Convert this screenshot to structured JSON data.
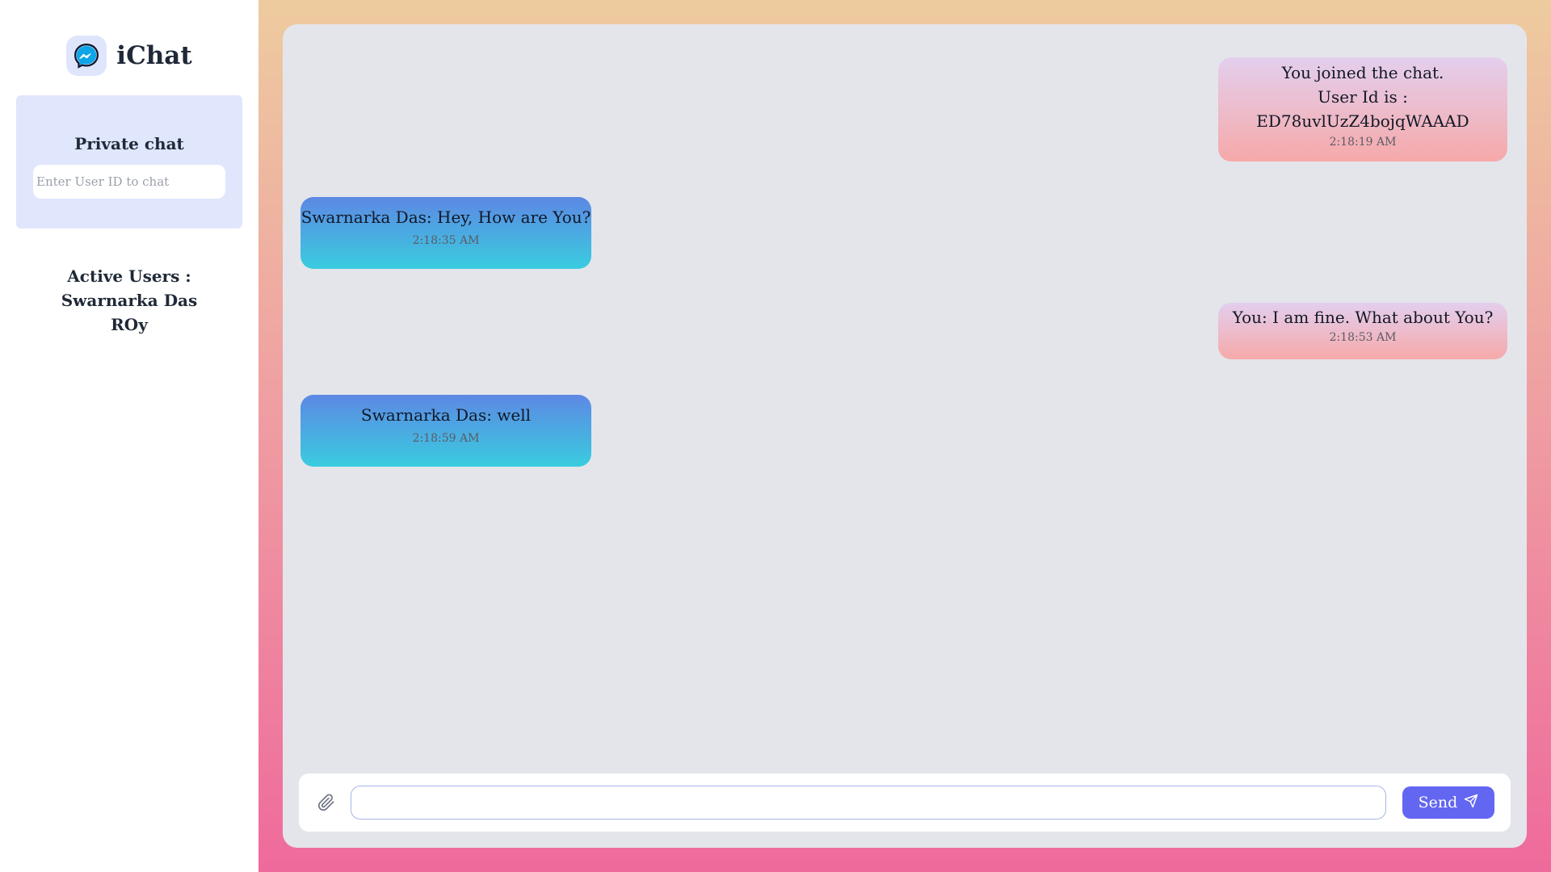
{
  "brand": {
    "title": "iChat",
    "logo_icon": "messenger-icon",
    "logo_color": "#0ea5e9"
  },
  "private_chat": {
    "title": "Private chat",
    "input_placeholder": "Enter User ID to chat",
    "input_value": ""
  },
  "active_users": {
    "heading": "Active Users :",
    "users": [
      "Swarnarka Das",
      "ROy"
    ]
  },
  "messages": [
    {
      "side": "mine",
      "lines": [
        "You joined the chat.",
        "User Id is :",
        "ED78uvlUzZ4bojqWAAAD"
      ],
      "time": "2:18:19 AM"
    },
    {
      "side": "theirs",
      "lines": [
        "Swarnarka Das: Hey, How are You?"
      ],
      "time": "2:18:35 AM"
    },
    {
      "side": "mine",
      "lines": [
        "You: I am fine. What about You?"
      ],
      "time": "2:18:53 AM"
    },
    {
      "side": "theirs",
      "lines": [
        "Swarnarka Das: well"
      ],
      "time": "2:18:59 AM"
    }
  ],
  "composer": {
    "attach_icon": "paperclip-icon",
    "input_value": "",
    "send_label": "Send",
    "send_icon": "paper-plane-icon",
    "send_color": "#6366f1"
  }
}
